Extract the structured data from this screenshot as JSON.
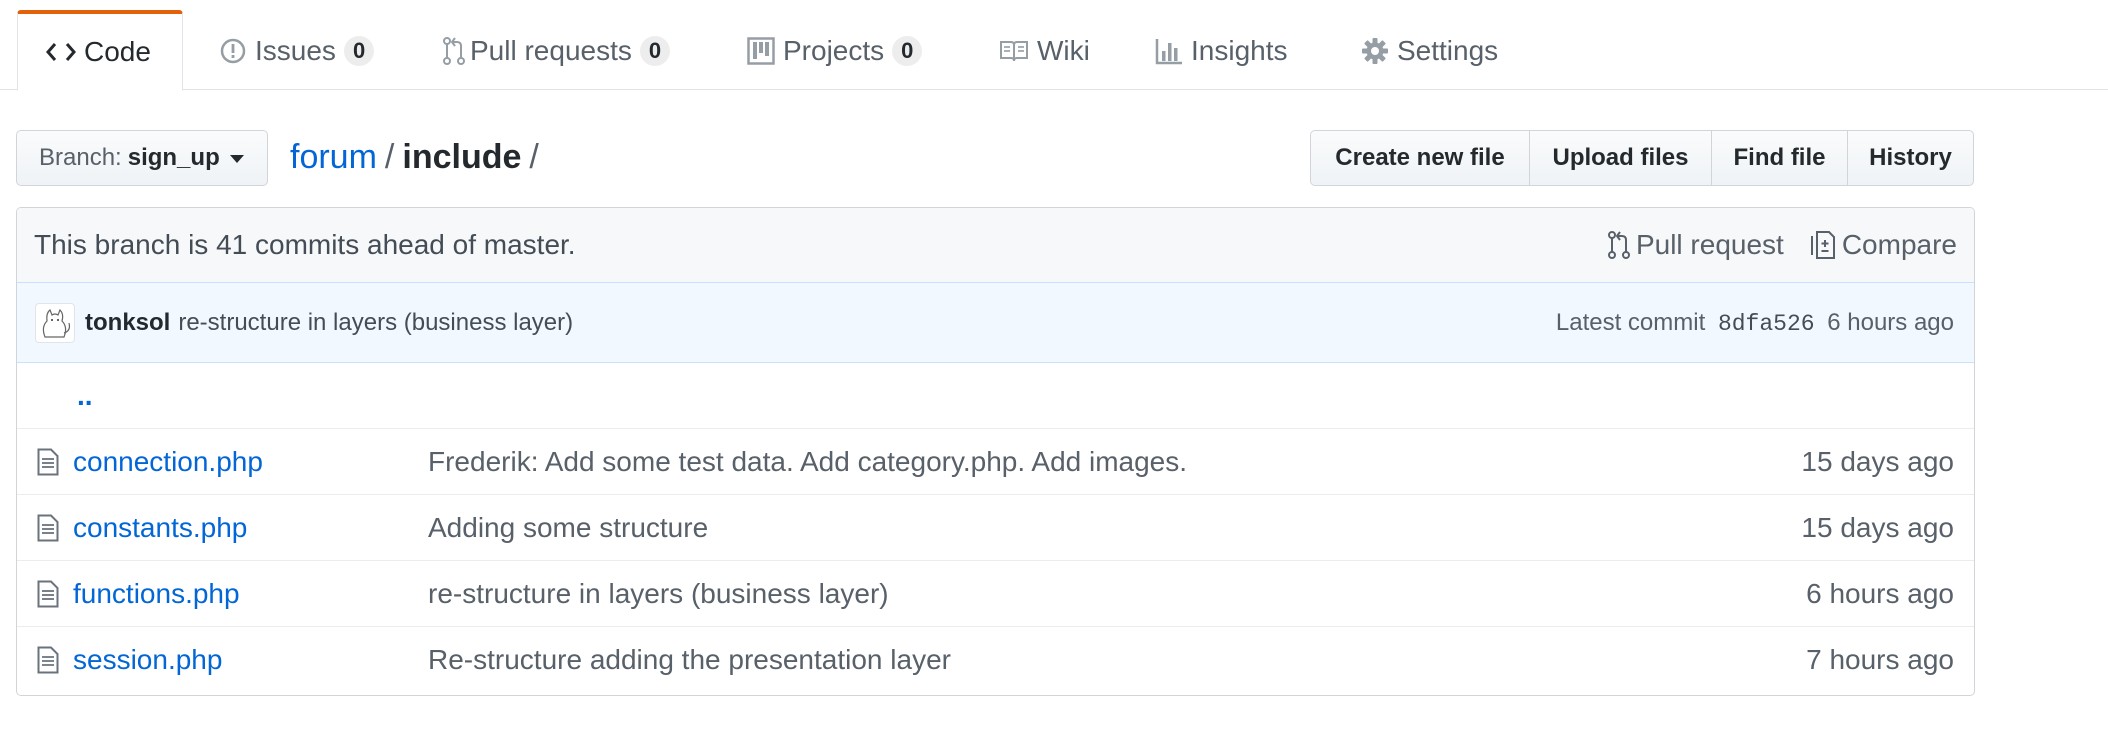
{
  "reponav": {
    "tabs": [
      {
        "label": "Code",
        "icon": "code-icon",
        "selected": true
      },
      {
        "label": "Issues",
        "icon": "issue-icon",
        "count": "0"
      },
      {
        "label": "Pull requests",
        "icon": "pull-request-icon",
        "count": "0"
      },
      {
        "label": "Projects",
        "icon": "project-icon",
        "count": "0"
      },
      {
        "label": "Wiki",
        "icon": "book-icon"
      },
      {
        "label": "Insights",
        "icon": "graph-icon"
      },
      {
        "label": "Settings",
        "icon": "gear-icon"
      }
    ]
  },
  "branch": {
    "prefix": "Branch:",
    "name": "sign_up"
  },
  "breadcrumb": {
    "repo": "forum",
    "sep1": "/",
    "dir": "include",
    "sep2": "/"
  },
  "actions": {
    "create_new_file": "Create new file",
    "upload_files": "Upload files",
    "find_file": "Find file",
    "history": "History"
  },
  "branch_info": {
    "text": "This branch is 41 commits ahead of master.",
    "pull_request": "Pull request",
    "compare": "Compare"
  },
  "latest_commit": {
    "author": "tonksol",
    "message": "re-structure in layers (business layer)",
    "prefix": "Latest commit",
    "sha": "8dfa526",
    "age": "6 hours ago"
  },
  "up_link": "..",
  "files": [
    {
      "name": "connection.php",
      "message": "Frederik: Add some test data. Add category.php. Add images.",
      "age": "15 days ago"
    },
    {
      "name": "constants.php",
      "message": "Adding some structure",
      "age": "15 days ago"
    },
    {
      "name": "functions.php",
      "message": "re-structure in layers (business layer)",
      "age": "6 hours ago"
    },
    {
      "name": "session.php",
      "message": "Re-structure adding the presentation layer",
      "age": "7 hours ago"
    }
  ],
  "colors": {
    "link": "#0366d6",
    "selected_tab_accent": "#e36209",
    "commit_bar_bg": "#f1f8ff",
    "muted_text": "#586069"
  }
}
